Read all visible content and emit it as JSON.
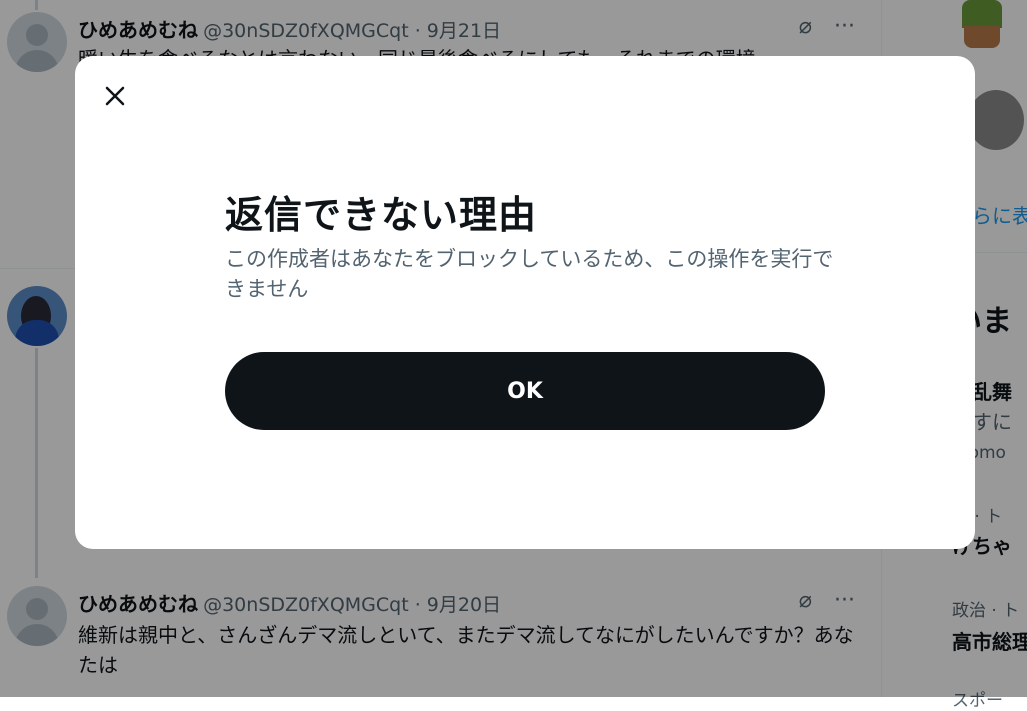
{
  "timeline": {
    "tweets": [
      {
        "name": "ひめあめむね",
        "handle": "@30nSDZ0fXQMGCqt · 9月21日",
        "text": "暖い牛を食べるなとは言わない。同じ最後食べるにしても、それまでの環境"
      },
      {
        "name": "ひめあめむね",
        "handle": "@30nSDZ0fXQMGCqt · 9月20日",
        "text": "維新は親中と、さんざんデマ流しといて、またデマ流してなにがしたいんですか？あなたは"
      }
    ]
  },
  "right_column": {
    "show_more": "さらに表",
    "section_title": "いま",
    "trend1_title": "剣乱舞",
    "trend1_sub": "ぱすに",
    "trend1_promo": "Promo",
    "trend2_cat": "楽 · ト",
    "trend2_title": "げちゃ",
    "trend3_cat": "政治 · ト",
    "trend3_title": "高市総理",
    "trend4_cat": "スポー"
  },
  "modal": {
    "title": "返信できない理由",
    "description": "この作成者はあなたをブロックしているため、この操作を実行できません",
    "ok_label": "OK",
    "close_icon": "close-icon"
  }
}
